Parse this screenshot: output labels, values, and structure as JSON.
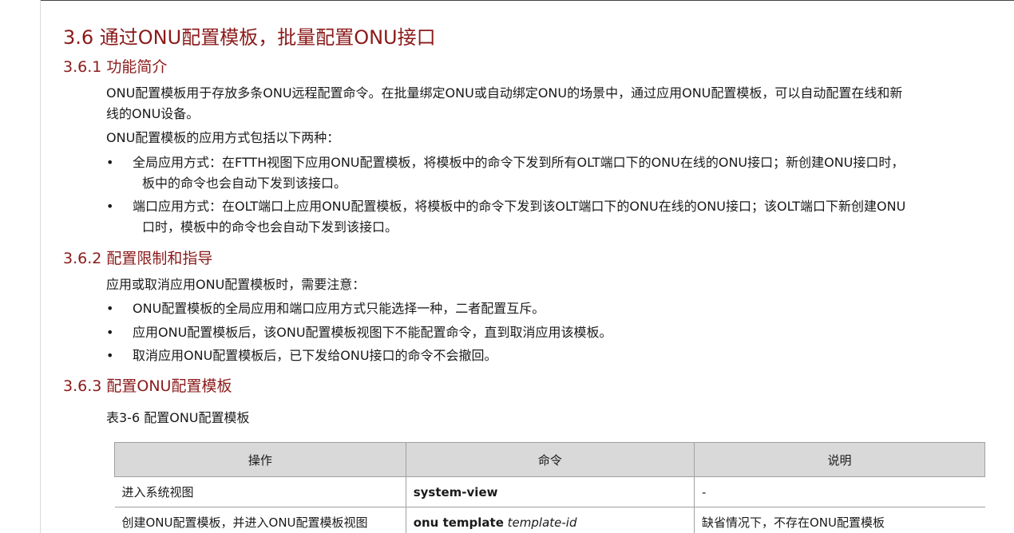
{
  "section": {
    "title": "3.6  通过ONU配置模板，批量配置ONU接口"
  },
  "s361": {
    "title": "3.6.1  功能简介",
    "para1_line1": "ONU配置模板用于存放多条ONU远程配置命令。在批量绑定ONU或自动绑定ONU的场景中，通过应用ONU配置模板，可以自动配置在线和新",
    "para1_line2": "线的ONU设备。",
    "para2": "ONU配置模板的应用方式包括以下两种：",
    "bullets": [
      {
        "line1": "全局应用方式：在FTTH视图下应用ONU配置模板，将模板中的命令下发到所有OLT端口下的ONU在线的ONU接口；新创建ONU接口时，",
        "line2": "板中的命令也会自动下发到该接口。"
      },
      {
        "line1": "端口应用方式：在OLT端口上应用ONU配置模板，将模板中的命令下发到该OLT端口下的ONU在线的ONU接口；该OLT端口下新创建ONU",
        "line2": "口时，模板中的命令也会自动下发到该接口。"
      }
    ]
  },
  "s362": {
    "title": "3.6.2  配置限制和指导",
    "para": "应用或取消应用ONU配置模板时，需要注意：",
    "bullets": [
      "ONU配置模板的全局应用和端口应用方式只能选择一种，二者配置互斥。",
      "应用ONU配置模板后，该ONU配置模板视图下不能配置命令，直到取消应用该模板。",
      "取消应用ONU配置模板后，已下发给ONU接口的命令不会撤回。"
    ]
  },
  "s363": {
    "title": "3.6.3  配置ONU配置模板",
    "caption": "表3-6 配置ONU配置模板",
    "table": {
      "headers": [
        "操作",
        "命令",
        "说明"
      ],
      "rows": [
        {
          "op": "进入系统视图",
          "cmd": "system-view",
          "cmd_arg": "",
          "note": "-"
        },
        {
          "op": "创建ONU配置模板，并进入ONU配置模板视图",
          "cmd": "onu template",
          "cmd_arg": "template-id",
          "note": "缺省情况下，不存在ONU配置模板"
        }
      ]
    }
  },
  "glyphs": {
    "bullet": "•"
  }
}
